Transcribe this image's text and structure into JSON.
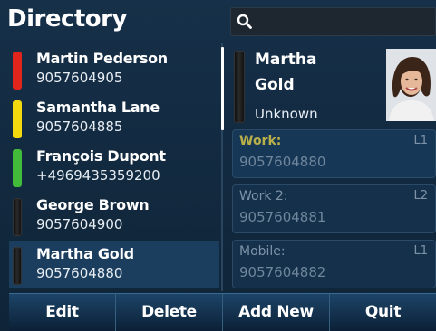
{
  "header": {
    "title": "Directory"
  },
  "search": {
    "icon": "search-icon"
  },
  "contacts": [
    {
      "name": "Martin Pederson",
      "number": "9057604905",
      "status": "red"
    },
    {
      "name": "Samantha Lane",
      "number": "9057604885",
      "status": "yellow"
    },
    {
      "name": "François Dupont",
      "number": "+4969435359200",
      "status": "green"
    },
    {
      "name": "George Brown",
      "number": "9057604900",
      "status": "black"
    },
    {
      "name": "Martha Gold",
      "number": "9057604880",
      "status": "black",
      "selected": true
    }
  ],
  "detail": {
    "first_name": "Martha",
    "last_name": "Gold",
    "presence": "Unknown",
    "numbers": [
      {
        "label": "Work:",
        "line": "L1",
        "number": "9057604880"
      },
      {
        "label": "Work 2:",
        "line": "L2",
        "number": "9057604881"
      },
      {
        "label": "Mobile:",
        "line": "L1",
        "number": "9057604882"
      }
    ]
  },
  "softkeys": {
    "edit": "Edit",
    "delete": "Delete",
    "add_new": "Add New",
    "quit": "Quit"
  },
  "colors": {
    "red": "#e1251d",
    "yellow": "#f3d90e",
    "green": "#42ba3a",
    "background": "#0f2437",
    "selected": "#1b3d5e"
  }
}
